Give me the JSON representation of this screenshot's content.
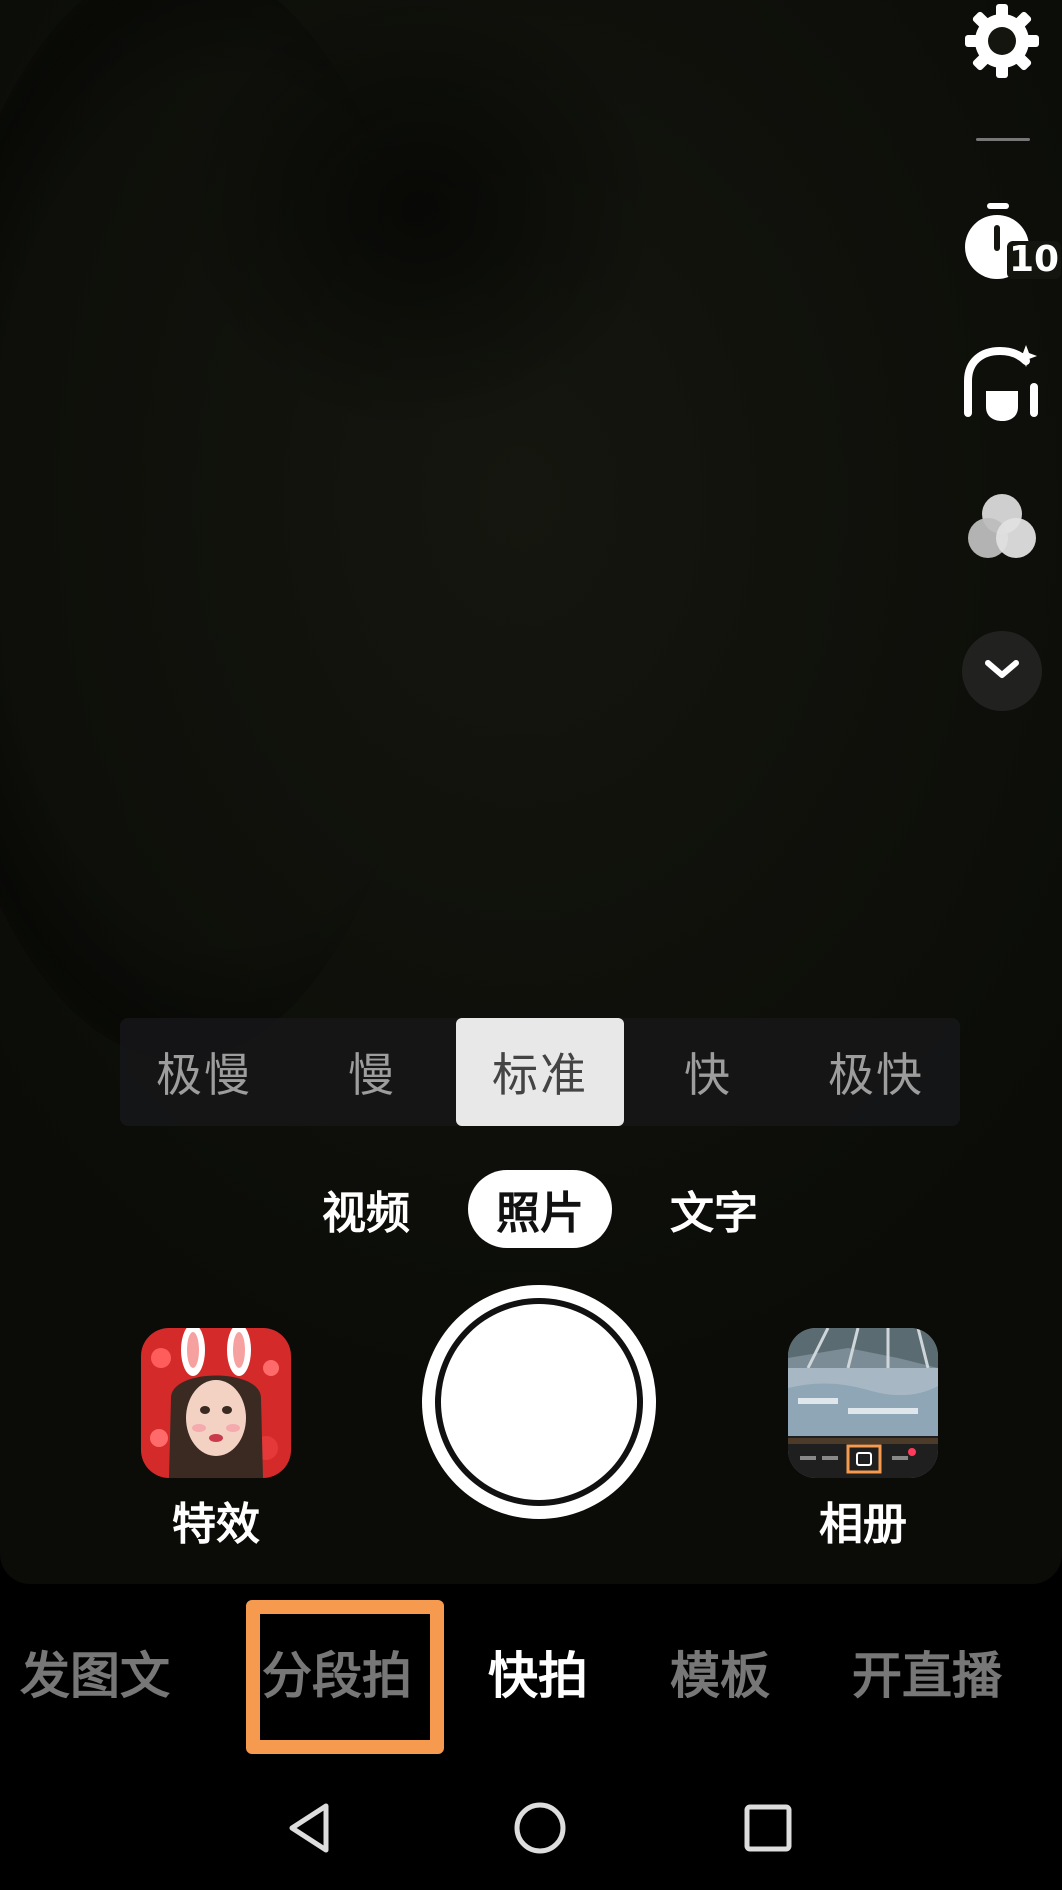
{
  "right_toolbar": {
    "settings_icon": "gear-icon",
    "timer_icon": "timer-icon",
    "timer_value": "10",
    "beauty_icon": "beauty-icon",
    "filter_icon": "filter-icon",
    "more_icon": "chevron-down-icon"
  },
  "speed": {
    "options": [
      "极慢",
      "慢",
      "标准",
      "快",
      "极快"
    ],
    "selected": "标准"
  },
  "modes": {
    "video": "视频",
    "photo": "照片",
    "text": "文字",
    "selected": "照片"
  },
  "controls": {
    "effects_label": "特效",
    "album_label": "相册"
  },
  "bottom_tabs": {
    "items": [
      "发图文",
      "分段拍",
      "快拍",
      "模板",
      "开直播"
    ],
    "selected": "快拍",
    "highlighted": "分段拍"
  },
  "colors": {
    "highlight": "#f59a4e",
    "speed_active_bg": "#e8e8e8"
  }
}
